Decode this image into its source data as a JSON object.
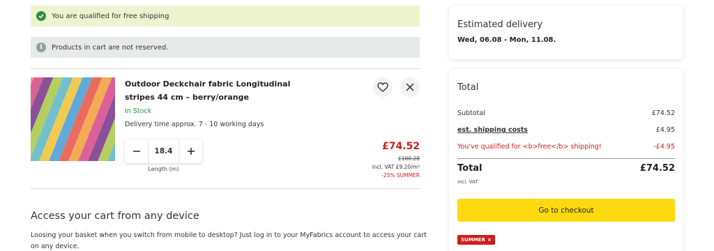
{
  "banners": {
    "shipping": "You are qualified for free shipping",
    "reserved": "Products in cart are not reserved."
  },
  "product": {
    "name": "Outdoor Deckchair fabric Longitudinal stripes 44 cm – berry/orange",
    "stock": "In Stock",
    "delivery_time": "Delivery time approx. 7 - 10 working days",
    "quantity": "18.4",
    "quantity_label": "Length (m)",
    "price": "£74.52",
    "old_price": "£100.28",
    "vat_price": "incl. VAT £9.20/m²",
    "discount": "-25% SUMMER",
    "image_colors": [
      "#e8574a",
      "#f2a03d",
      "#d64c8a",
      "#7b3a8a",
      "#a8c94a",
      "#5fb8c7",
      "#f0c43a",
      "#4a9fd6"
    ]
  },
  "access": {
    "title": "Access your cart from any device",
    "text": "Loosing your basket when you switch from mobile to desktop? Just log in to your MyFabrics account to access your cart on any device."
  },
  "delivery": {
    "title": "Estimated delivery",
    "dates": "Wed, 06.08 - Mon, 11.08."
  },
  "totals": {
    "title": "Total",
    "subtotal_label": "Subtotal",
    "subtotal_value": "£74.52",
    "shipping_label": "est. shipping costs",
    "shipping_value": "£4.95",
    "free_label": "You've qualified for <b>free</b> shipping!",
    "free_value": "-£4.95",
    "total_label": "Total",
    "total_value": "£74.52",
    "incl_vat": "incl. VAT",
    "checkout_label": "Go to checkout",
    "coupon": "SUMMER",
    "coupon_remove": "×"
  },
  "colors": {
    "accent_yellow": "#ffd90f",
    "price_red": "#d01c1c",
    "stock_green": "#2f8f3f",
    "banner_green": "#eef3cf",
    "banner_grey": "#e6ebe8"
  }
}
